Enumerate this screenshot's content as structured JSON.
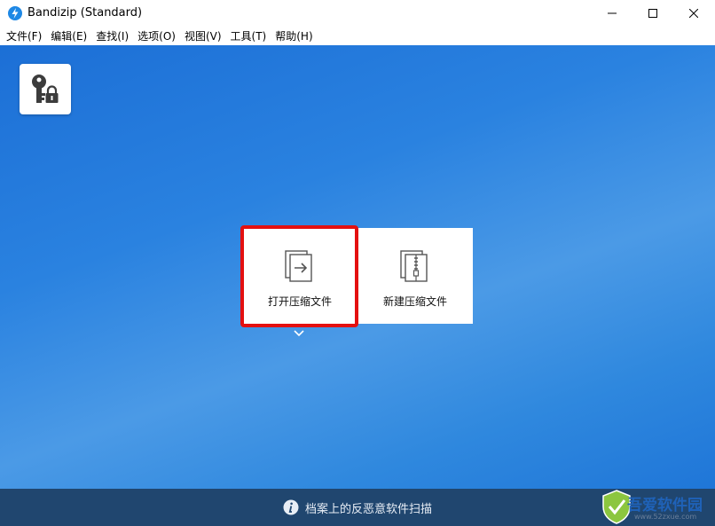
{
  "window": {
    "title": "Bandizip (Standard)"
  },
  "menu": {
    "items": [
      "文件(F)",
      "编辑(E)",
      "查找(I)",
      "选项(O)",
      "视图(V)",
      "工具(T)",
      "帮助(H)"
    ]
  },
  "actions": {
    "open_label": "打开压缩文件",
    "new_label": "新建压缩文件"
  },
  "status": {
    "text": "档案上的反恶意软件扫描"
  },
  "watermark": {
    "text": "吾爱软件园",
    "url": "www.52zxue.com"
  },
  "colors": {
    "accent_red": "#e41010",
    "status_bg": "#20466f",
    "main_bg": "#2a82e0"
  },
  "icons": [
    "bandizip-logo-icon",
    "minimize-icon",
    "maximize-icon",
    "close-icon",
    "key-lock-icon",
    "open-archive-icon",
    "new-archive-icon",
    "chevron-down-icon",
    "info-icon"
  ]
}
